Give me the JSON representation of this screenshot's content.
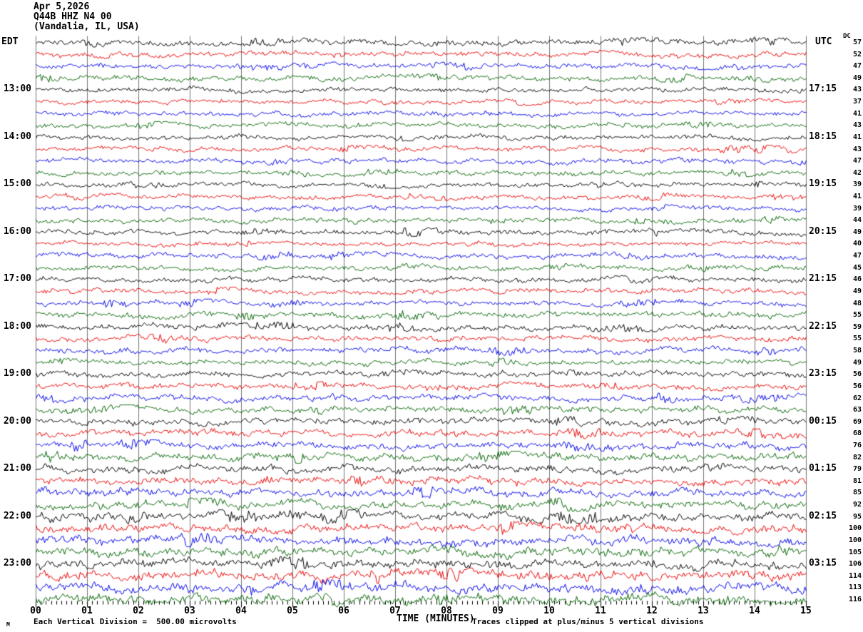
{
  "header": {
    "date": "Apr 5,2026",
    "station": "Q44B HHZ N4 00",
    "location": "(Vandalia, IL, USA)"
  },
  "left_axis": {
    "label": "EDT",
    "times": [
      "13:00",
      "14:00",
      "15:00",
      "16:00",
      "17:00",
      "18:00",
      "19:00",
      "20:00",
      "21:00",
      "22:00",
      "23:00"
    ]
  },
  "right_axis": {
    "label": "UTC",
    "dc_label": "DC",
    "times": [
      "17:15",
      "18:15",
      "19:15",
      "20:15",
      "21:15",
      "22:15",
      "23:15",
      "00:15",
      "01:15",
      "02:15",
      "03:15"
    ]
  },
  "bottom_axis": {
    "label": "TIME (MINUTES)",
    "ticks": [
      "00",
      "01",
      "02",
      "03",
      "04",
      "05",
      "06",
      "07",
      "08",
      "09",
      "10",
      "11",
      "12",
      "13",
      "14",
      "15"
    ]
  },
  "footer": {
    "left_glyph": "M",
    "scale_note": "Each Vertical Division =  500.00 microvolts",
    "clip_note": "Traces clipped at plus/minus 5 vertical divisions"
  },
  "colors": {
    "background": "#ffffff",
    "grid": "#757575",
    "text": "#000000",
    "trace_black": "#000000",
    "trace_red": "#e80000",
    "trace_blue": "#0000e8",
    "trace_green": "#006400"
  },
  "chart_data": {
    "type": "line",
    "title": "Q44B HHZ N4 00 (Vandalia, IL, USA) Apr 5,2026",
    "xlabel": "TIME (MINUTES)",
    "x_range": [
      0,
      15
    ],
    "x_tick_labels": [
      "00",
      "01",
      "02",
      "03",
      "04",
      "05",
      "06",
      "07",
      "08",
      "09",
      "10",
      "11",
      "12",
      "13",
      "14",
      "15"
    ],
    "grid": "vertical-gridlines-every-minute",
    "rows_total": 48,
    "rows_per_hour": 4,
    "row_duration_minutes": 15,
    "trace_color_cycle": [
      "#000000",
      "#e80000",
      "#0000e8",
      "#006400"
    ],
    "hour_label_rows_edt": [
      "13:00",
      "14:00",
      "15:00",
      "16:00",
      "17:00",
      "18:00",
      "19:00",
      "20:00",
      "21:00",
      "22:00",
      "23:00"
    ],
    "hour_label_rows_utc": [
      "17:15",
      "18:15",
      "19:15",
      "20:15",
      "21:15",
      "22:15",
      "23:15",
      "00:15",
      "01:15",
      "02:15",
      "03:15"
    ],
    "dc_offsets": [
      57,
      52,
      47,
      49,
      43,
      37,
      41,
      43,
      41,
      43,
      47,
      42,
      39,
      41,
      39,
      44,
      49,
      40,
      47,
      45,
      46,
      49,
      48,
      55,
      59,
      55,
      58,
      49,
      56,
      56,
      62,
      63,
      69,
      68,
      76,
      82,
      79,
      81,
      85,
      92,
      95,
      100,
      100,
      105,
      106,
      114,
      113,
      116
    ],
    "amplitude_scale": "Each Vertical Division = 500.00 microvolts",
    "clipping": "Traces clipped at plus/minus 5 vertical divisions",
    "content": "48 consecutive 15-minute seismogram traces of background noise; DC offset value shown per trace at right"
  }
}
